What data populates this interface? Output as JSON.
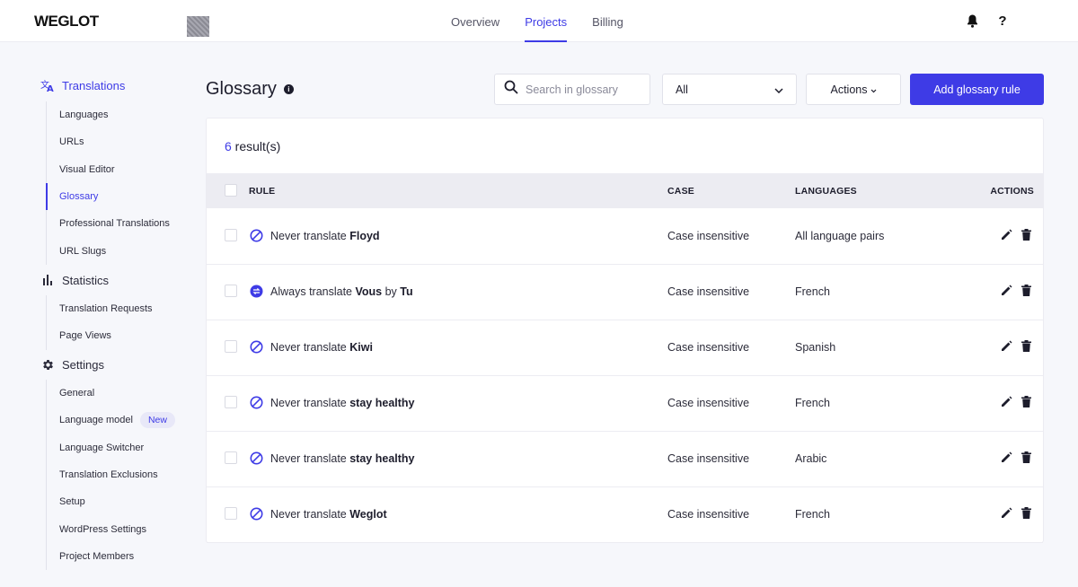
{
  "app": {
    "logo": "WEGLOT"
  },
  "topnav": {
    "items": [
      {
        "label": "Overview",
        "active": false
      },
      {
        "label": "Projects",
        "active": true
      },
      {
        "label": "Billing",
        "active": false
      }
    ],
    "help_label": "?"
  },
  "sidebar": {
    "translations": {
      "label": "Translations",
      "items": [
        "Languages",
        "URLs",
        "Visual Editor",
        "Glossary",
        "Professional Translations",
        "URL Slugs"
      ]
    },
    "statistics": {
      "label": "Statistics",
      "items": [
        "Translation Requests",
        "Page Views"
      ]
    },
    "settings": {
      "label": "Settings",
      "items": [
        "General",
        "Language model",
        "Language Switcher",
        "Translation Exclusions",
        "Setup",
        "WordPress Settings",
        "Project Members"
      ],
      "new_badge": "New"
    }
  },
  "page": {
    "title": "Glossary",
    "search_placeholder": "Search in glossary",
    "filter_value": "All",
    "actions_label": "Actions",
    "add_button": "Add glossary rule"
  },
  "results": {
    "count": "6",
    "suffix": " result(s)"
  },
  "table": {
    "headers": {
      "rule": "RULE",
      "case": "CASE",
      "languages": "LANGUAGES",
      "actions": "ACTIONS"
    },
    "rows": [
      {
        "type": "never",
        "prefix": "Never translate ",
        "word": "Floyd",
        "mid": "",
        "word2": "",
        "case": "Case insensitive",
        "languages": "All language pairs"
      },
      {
        "type": "always",
        "prefix": "Always translate ",
        "word": "Vous",
        "mid": " by ",
        "word2": "Tu",
        "case": "Case insensitive",
        "languages": "French"
      },
      {
        "type": "never",
        "prefix": "Never translate ",
        "word": "Kiwi",
        "mid": "",
        "word2": "",
        "case": "Case insensitive",
        "languages": "Spanish"
      },
      {
        "type": "never",
        "prefix": "Never translate ",
        "word": "stay healthy",
        "mid": "",
        "word2": "",
        "case": "Case insensitive",
        "languages": "French"
      },
      {
        "type": "never",
        "prefix": "Never translate ",
        "word": "stay healthy",
        "mid": "",
        "word2": "",
        "case": "Case insensitive",
        "languages": "Arabic"
      },
      {
        "type": "never",
        "prefix": "Never translate ",
        "word": "Weglot",
        "mid": "",
        "word2": "",
        "case": "Case insensitive",
        "languages": "French"
      }
    ]
  },
  "colors": {
    "accent": "#3e3be6",
    "background": "#f6f7fb",
    "header_row": "#ececf2"
  }
}
